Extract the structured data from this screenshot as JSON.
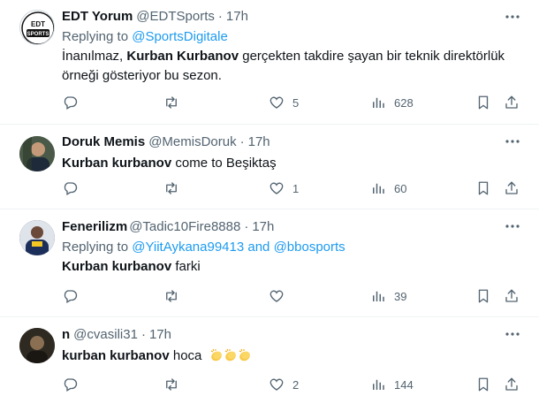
{
  "tweets": [
    {
      "name": "EDT Yorum",
      "handle": "@EDTSports",
      "separator": "·",
      "time": "17h",
      "replying_prefix": "Replying to ",
      "replying_to": "@SportsDigitale",
      "replying_and": "",
      "replying_to_2": "",
      "text_before": "İnanılmaz, ",
      "text_bold": "Kurban Kurbanov",
      "text_after": " gerçekten takdire şayan bir teknik direktörlük örneği gösteriyor bu sezon.",
      "avatar_text_top": "EDT",
      "avatar_text_bottom": "SPORTS",
      "likes": "5",
      "views": "628"
    },
    {
      "name": "Doruk Memis",
      "handle": "@MemisDoruk",
      "separator": "·",
      "time": "17h",
      "text_bold": "Kurban kurbanov",
      "text_after": " come to Beşiktaş",
      "likes": "1",
      "views": "60"
    },
    {
      "name": "Fenerilizm",
      "handle": "@Tadic10Fire8888",
      "separator": "·",
      "time": "17h",
      "replying_prefix": "Replying to ",
      "replying_to": "@YiitAykana99413",
      "replying_and": " and ",
      "replying_to_2": "@bbosports",
      "text_bold": "Kurban kurbanov",
      "text_after": " farki",
      "views": "39"
    },
    {
      "name": "n",
      "handle": "@cvasili31",
      "separator": "·",
      "time": "17h",
      "text_bold": "kurban kurbanov",
      "text_after": " hoca",
      "emoji": "clapping-hands x3",
      "likes": "2",
      "views": "144"
    }
  ],
  "colors": {
    "text": "#0f1419",
    "secondary": "#536471",
    "link": "#1d9bf0",
    "divider": "#eff3f4"
  },
  "icons": [
    "reply-icon",
    "retweet-icon",
    "like-icon",
    "views-icon",
    "bookmark-icon",
    "share-icon",
    "more-icon"
  ]
}
